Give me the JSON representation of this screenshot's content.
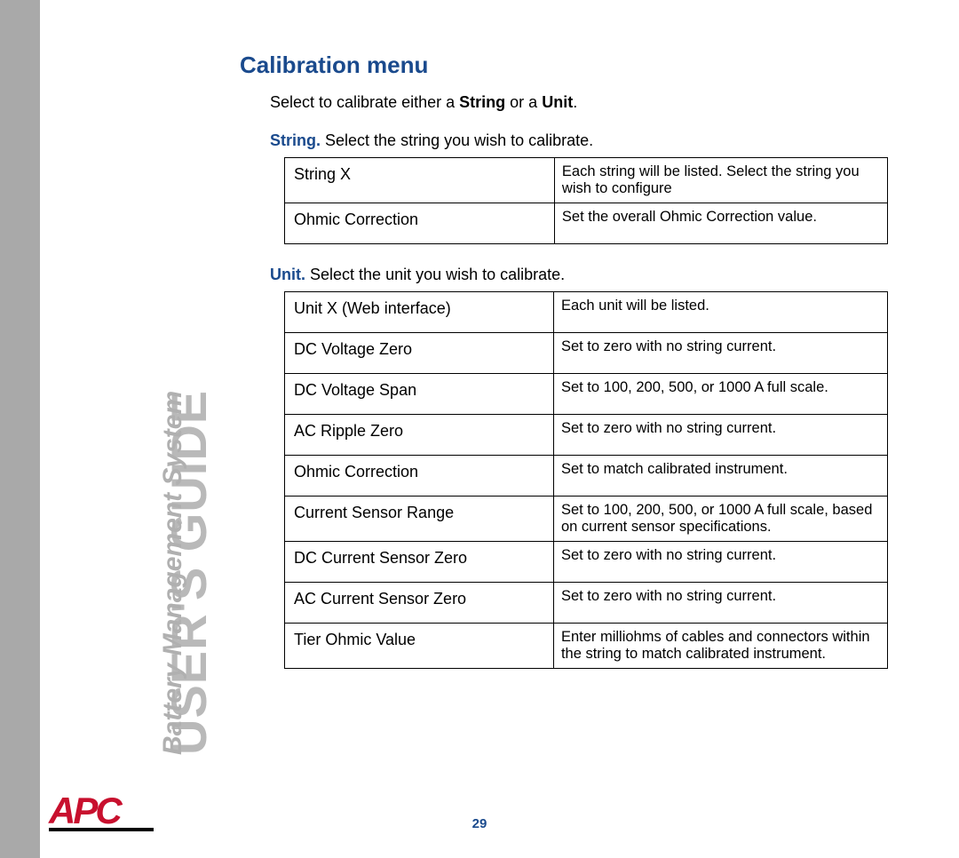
{
  "sidebar": {
    "title": "USER'S GUIDE",
    "subtitle": "Battery Management System"
  },
  "heading": "Calibration menu",
  "intro_prefix": "Select to calibrate either a",
  "intro_strong1": "String",
  "intro_mid": "or a",
  "intro_strong2": "Unit",
  "string_section": {
    "label": "String.",
    "text": "Select the string you wish to calibrate.",
    "rows": [
      {
        "name": "String X",
        "desc": "Each string will be listed. Select the string you wish to configure"
      },
      {
        "name": "Ohmic Correction",
        "desc": "Set the overall Ohmic Correction value."
      }
    ]
  },
  "unit_section": {
    "label": "Unit.",
    "text": "Select the unit you wish to calibrate.",
    "rows": [
      {
        "name": "Unit X (Web interface)",
        "desc": "Each unit will be listed."
      },
      {
        "name": "DC Voltage Zero",
        "desc": "Set to zero with no string current."
      },
      {
        "name": "DC Voltage Span",
        "desc": "Set to 100, 200, 500, or 1000 A full scale."
      },
      {
        "name": "AC Ripple Zero",
        "desc": "Set to zero with no string current."
      },
      {
        "name": "Ohmic Correction",
        "desc": "Set to match calibrated instrument."
      },
      {
        "name": "Current Sensor Range",
        "desc": "Set to 100, 200, 500, or 1000 A full scale, based on current sensor specifications."
      },
      {
        "name": "DC Current Sensor Zero",
        "desc": "Set to zero with no string current."
      },
      {
        "name": "AC Current Sensor Zero",
        "desc": "Set to zero with no string current."
      },
      {
        "name": "Tier Ohmic Value",
        "desc": "Enter milliohms of cables and connectors within the string to match calibrated instrument."
      }
    ]
  },
  "logo": "APC",
  "page_number": "29"
}
